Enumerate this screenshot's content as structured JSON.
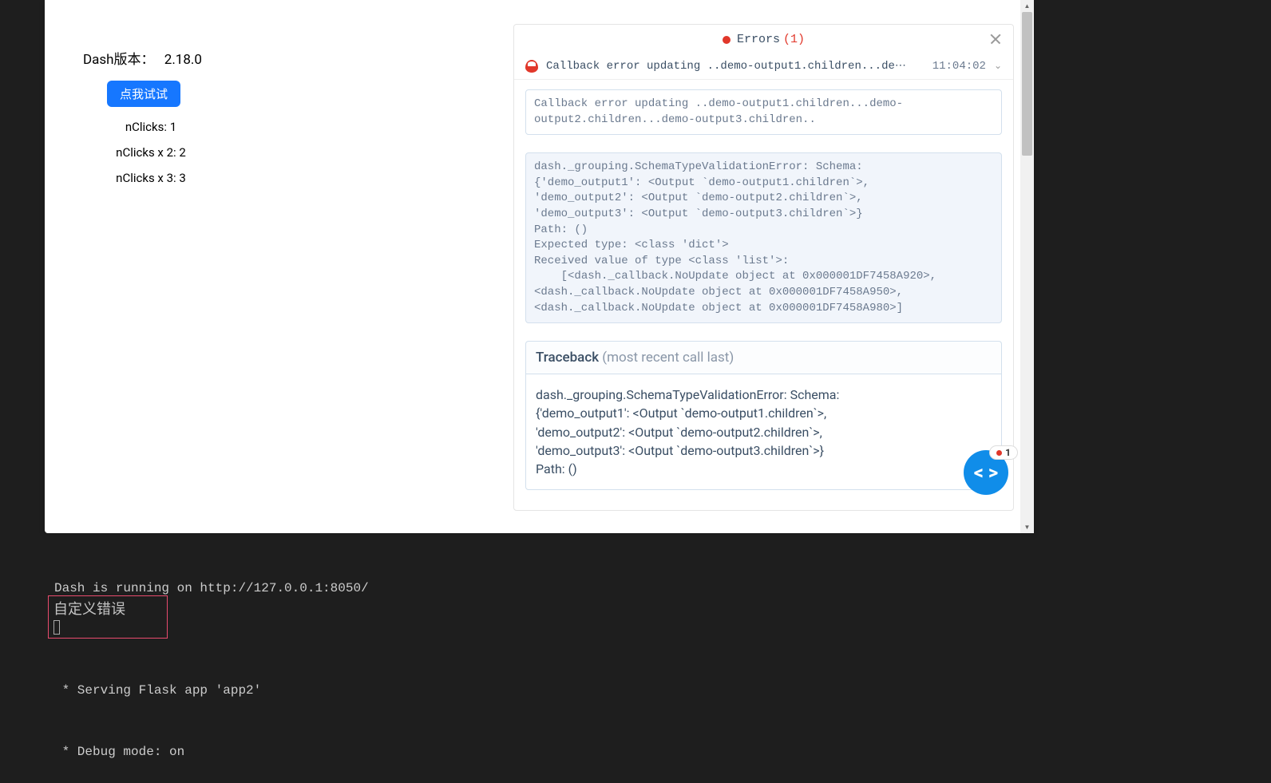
{
  "app": {
    "version_label": "Dash版本：",
    "version": "2.18.0",
    "button_label": "点我试试",
    "outputs": {
      "n1": "nClicks: 1",
      "n2": "nClicks x 2: 2",
      "n3": "nClicks x 3: 3"
    }
  },
  "error_panel": {
    "title": "Errors",
    "count": "(1)",
    "summary": "Callback error updating ..demo-output1.children...de⋯",
    "time": "11:04:02",
    "full_message": "Callback error updating ..demo-output1.children...demo-output2.children...demo-output3.children..",
    "stack": "dash._grouping.SchemaTypeValidationError: Schema:\n{'demo_output1': <Output `demo-output1.children`>,\n'demo_output2': <Output `demo-output2.children`>,\n'demo_output3': <Output `demo-output3.children`>}\nPath: ()\nExpected type: <class 'dict'>\nReceived value of type <class 'list'>:\n    [<dash._callback.NoUpdate object at 0x000001DF7458A920>,\n<dash._callback.NoUpdate object at 0x000001DF7458A950>,\n<dash._callback.NoUpdate object at 0x000001DF7458A980>]",
    "traceback_title": "Traceback",
    "traceback_subtitle": "(most recent call last)",
    "traceback_body": "dash._grouping.SchemaTypeValidationError: Schema:\n{'demo_output1': <Output `demo-output1.children`>,\n'demo_output2': <Output `demo-output2.children`>,\n'demo_output3': <Output `demo-output3.children`>}\nPath: ()"
  },
  "debug_fab": {
    "glyph": "< >",
    "badge_count": "1"
  },
  "terminal": {
    "line1": "Dash is running on http://127.0.0.1:8050/",
    "line2": "",
    "line3": " * Serving Flask app 'app2'",
    "line4": " * Debug mode: on"
  },
  "custom_error": {
    "text": "自定义错误"
  }
}
